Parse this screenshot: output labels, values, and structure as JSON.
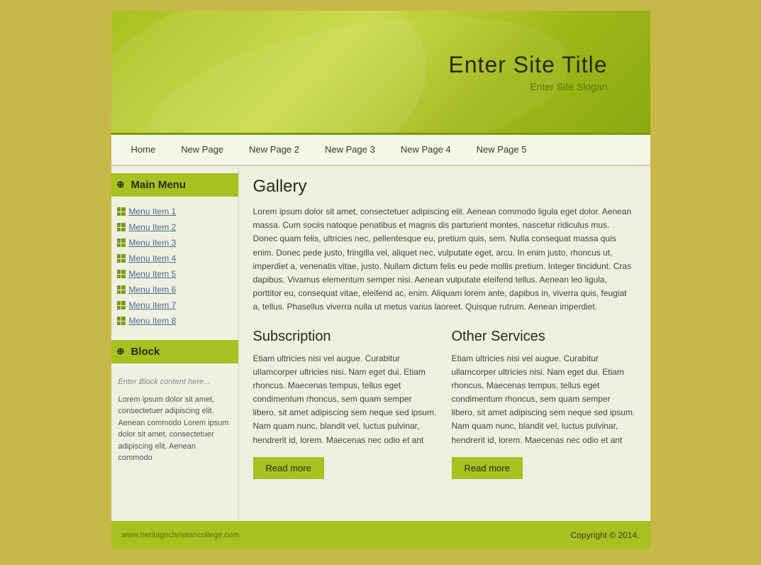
{
  "header": {
    "title": "Enter Site Title",
    "slogan": "Enter Site Slogan"
  },
  "nav": {
    "items": [
      {
        "label": "Home",
        "id": "home"
      },
      {
        "label": "New Page",
        "id": "new-page"
      },
      {
        "label": "New Page 2",
        "id": "new-page-2"
      },
      {
        "label": "New Page 3",
        "id": "new-page-3"
      },
      {
        "label": "New Page 4",
        "id": "new-page-4"
      },
      {
        "label": "New Page 5",
        "id": "new-page-5"
      }
    ]
  },
  "sidebar": {
    "main_menu_label": "Main Menu",
    "menu_items": [
      {
        "label": "Menu Item 1"
      },
      {
        "label": "Menu Item 2"
      },
      {
        "label": "Menu Item 3"
      },
      {
        "label": "Menu Item 4"
      },
      {
        "label": "Menu Item 5"
      },
      {
        "label": "Menu Item 6"
      },
      {
        "label": "Menu Item 7"
      },
      {
        "label": "Menu Item 8"
      }
    ],
    "block_label": "Block",
    "block_placeholder": "Enter Block content here...",
    "block_text": "Lorem ipsum dolor sit amet, consectetuer adipiscing elit. Aenean commodo Lorem ipsum dolor sit amet, consectetuer adipiscing elit. Aenean commodo"
  },
  "content": {
    "gallery_title": "Gallery",
    "gallery_text": "Lorem ipsum dolor sit amet, consectetuer adipiscing elit. Aenean commodo ligula eget dolor. Aenean massa. Cum sociis natoque penatibus et magnis dis parturient montes, nascetur ridiculus mus. Donec quam felis, ultricies nec, pellentesque eu, pretium quis, sem. Nulla consequat massa quis enim. Donec pede justo, fringilla vel, aliquet nec, vulputate eget, arcu. In enim justo, rhoncus ut, imperdiet a, venenatis vitae, justo. Nullam dictum felis eu pede mollis pretium. Integer tincidunt. Cras dapibus. Vivamus elementum semper nisi. Aenean vulputate eleifend tellus. Aenean leo ligula, porttitor eu, consequat vitae, eleifend ac, enim. Aliquam lorem ante, dapibus in, viverra quis, feugiat a, tellus. Phasellus viverra nulla ut metus varius laoreet. Quisque rutrum. Aenean imperdiet.",
    "subscription_title": "Subscription",
    "subscription_text": "Etiam ultricies nisi vel augue. Curabitur ullamcorper ultricies nisi. Nam eget dui. Etiam rhoncus. Maecenas tempus, tellus eget condimentum rhoncus, sem quam semper libero, sit amet adipiscing sem neque sed ipsum. Nam quam nunc, blandit vel, luctus pulvinar, hendrerit id, lorem. Maecenas nec odio et ant",
    "subscription_btn": "Read more",
    "other_title": "Other Services",
    "other_text": "Etiam ultricies nisi vel augue. Curabitur ullamcorper ultricies nisi. Nam eget dui. Etiam rhoncus. Maecenas tempus, tellus eget condimentum rhoncus, sem quam semper libero, sit amet adipiscing sem neque sed ipsum. Nam quam nunc, blandit vel, luctus pulvinar, hendrerit id, lorem. Maecenas nec odio et ant",
    "other_btn": "Read more"
  },
  "footer": {
    "link_text": "www.heritagechristiancollege.com",
    "copyright": "Copyright © 2014."
  }
}
